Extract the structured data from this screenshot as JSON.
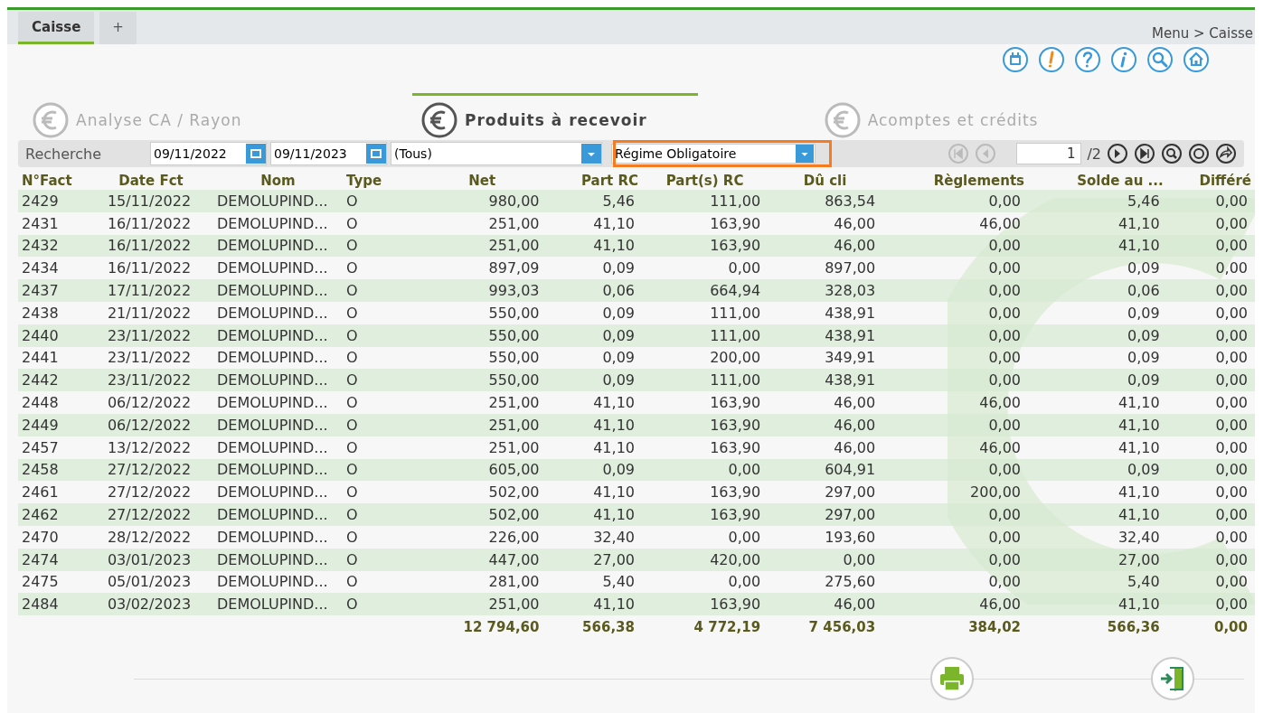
{
  "tabs": [
    {
      "label": "Caisse",
      "selected": true
    },
    {
      "label": "+",
      "selected": false
    }
  ],
  "breadcrumb": "Menu > Caisse",
  "sections": [
    {
      "label": "Analyse CA / Rayon",
      "selected": false
    },
    {
      "label": "Produits à recevoir",
      "selected": true
    },
    {
      "label": "Acomptes et crédits",
      "selected": false
    }
  ],
  "search": {
    "label": "Recherche",
    "date_from": "09/11/2022",
    "date_to": "09/11/2023",
    "filter": "(Tous)",
    "regime": "Régime Obligatoire",
    "page": "1",
    "pages": "/2"
  },
  "table": {
    "columns": [
      "N°Fact",
      "Date Fct",
      "Nom",
      "Type",
      "Net",
      "Part RC",
      "Part(s) RC",
      "Dû cli",
      "Règlements",
      "Solde au ...",
      "Différé"
    ],
    "rows": [
      [
        "2429",
        "15/11/2022",
        "DEMOLUPIND...",
        "O",
        "980,00",
        "5,46",
        "111,00",
        "863,54",
        "0,00",
        "5,46",
        "0,00"
      ],
      [
        "2431",
        "16/11/2022",
        "DEMOLUPIND...",
        "O",
        "251,00",
        "41,10",
        "163,90",
        "46,00",
        "46,00",
        "41,10",
        "0,00"
      ],
      [
        "2432",
        "16/11/2022",
        "DEMOLUPIND...",
        "O",
        "251,00",
        "41,10",
        "163,90",
        "46,00",
        "0,00",
        "41,10",
        "0,00"
      ],
      [
        "2434",
        "16/11/2022",
        "DEMOLUPIND...",
        "O",
        "897,09",
        "0,09",
        "0,00",
        "897,00",
        "0,00",
        "0,09",
        "0,00"
      ],
      [
        "2437",
        "17/11/2022",
        "DEMOLUPIND...",
        "O",
        "993,03",
        "0,06",
        "664,94",
        "328,03",
        "0,00",
        "0,06",
        "0,00"
      ],
      [
        "2438",
        "21/11/2022",
        "DEMOLUPIND...",
        "O",
        "550,00",
        "0,09",
        "111,00",
        "438,91",
        "0,00",
        "0,09",
        "0,00"
      ],
      [
        "2440",
        "23/11/2022",
        "DEMOLUPIND...",
        "O",
        "550,00",
        "0,09",
        "111,00",
        "438,91",
        "0,00",
        "0,09",
        "0,00"
      ],
      [
        "2441",
        "23/11/2022",
        "DEMOLUPIND...",
        "O",
        "550,00",
        "0,09",
        "200,00",
        "349,91",
        "0,00",
        "0,09",
        "0,00"
      ],
      [
        "2442",
        "23/11/2022",
        "DEMOLUPIND...",
        "O",
        "550,00",
        "0,09",
        "111,00",
        "438,91",
        "0,00",
        "0,09",
        "0,00"
      ],
      [
        "2448",
        "06/12/2022",
        "DEMOLUPIND...",
        "O",
        "251,00",
        "41,10",
        "163,90",
        "46,00",
        "46,00",
        "41,10",
        "0,00"
      ],
      [
        "2449",
        "06/12/2022",
        "DEMOLUPIND...",
        "O",
        "251,00",
        "41,10",
        "163,90",
        "46,00",
        "0,00",
        "41,10",
        "0,00"
      ],
      [
        "2457",
        "13/12/2022",
        "DEMOLUPIND...",
        "O",
        "251,00",
        "41,10",
        "163,90",
        "46,00",
        "46,00",
        "41,10",
        "0,00"
      ],
      [
        "2458",
        "27/12/2022",
        "DEMOLUPIND...",
        "O",
        "605,00",
        "0,09",
        "0,00",
        "604,91",
        "0,00",
        "0,09",
        "0,00"
      ],
      [
        "2461",
        "27/12/2022",
        "DEMOLUPIND...",
        "O",
        "502,00",
        "41,10",
        "163,90",
        "297,00",
        "200,00",
        "41,10",
        "0,00"
      ],
      [
        "2462",
        "27/12/2022",
        "DEMOLUPIND...",
        "O",
        "502,00",
        "41,10",
        "163,90",
        "297,00",
        "0,00",
        "41,10",
        "0,00"
      ],
      [
        "2470",
        "28/12/2022",
        "DEMOLUPIND...",
        "O",
        "226,00",
        "32,40",
        "0,00",
        "193,60",
        "0,00",
        "32,40",
        "0,00"
      ],
      [
        "2474",
        "03/01/2023",
        "DEMOLUPIND...",
        "O",
        "447,00",
        "27,00",
        "420,00",
        "0,00",
        "0,00",
        "27,00",
        "0,00"
      ],
      [
        "2475",
        "05/01/2023",
        "DEMOLUPIND...",
        "O",
        "281,00",
        "5,40",
        "0,00",
        "275,60",
        "0,00",
        "5,40",
        "0,00"
      ],
      [
        "2484",
        "03/02/2023",
        "DEMOLUPIND...",
        "O",
        "251,00",
        "41,10",
        "163,90",
        "46,00",
        "46,00",
        "41,10",
        "0,00"
      ]
    ],
    "totals": [
      "12 794,60",
      "566,38",
      "4 772,19",
      "7 456,03",
      "384,02",
      "566,36",
      "0,00"
    ]
  }
}
